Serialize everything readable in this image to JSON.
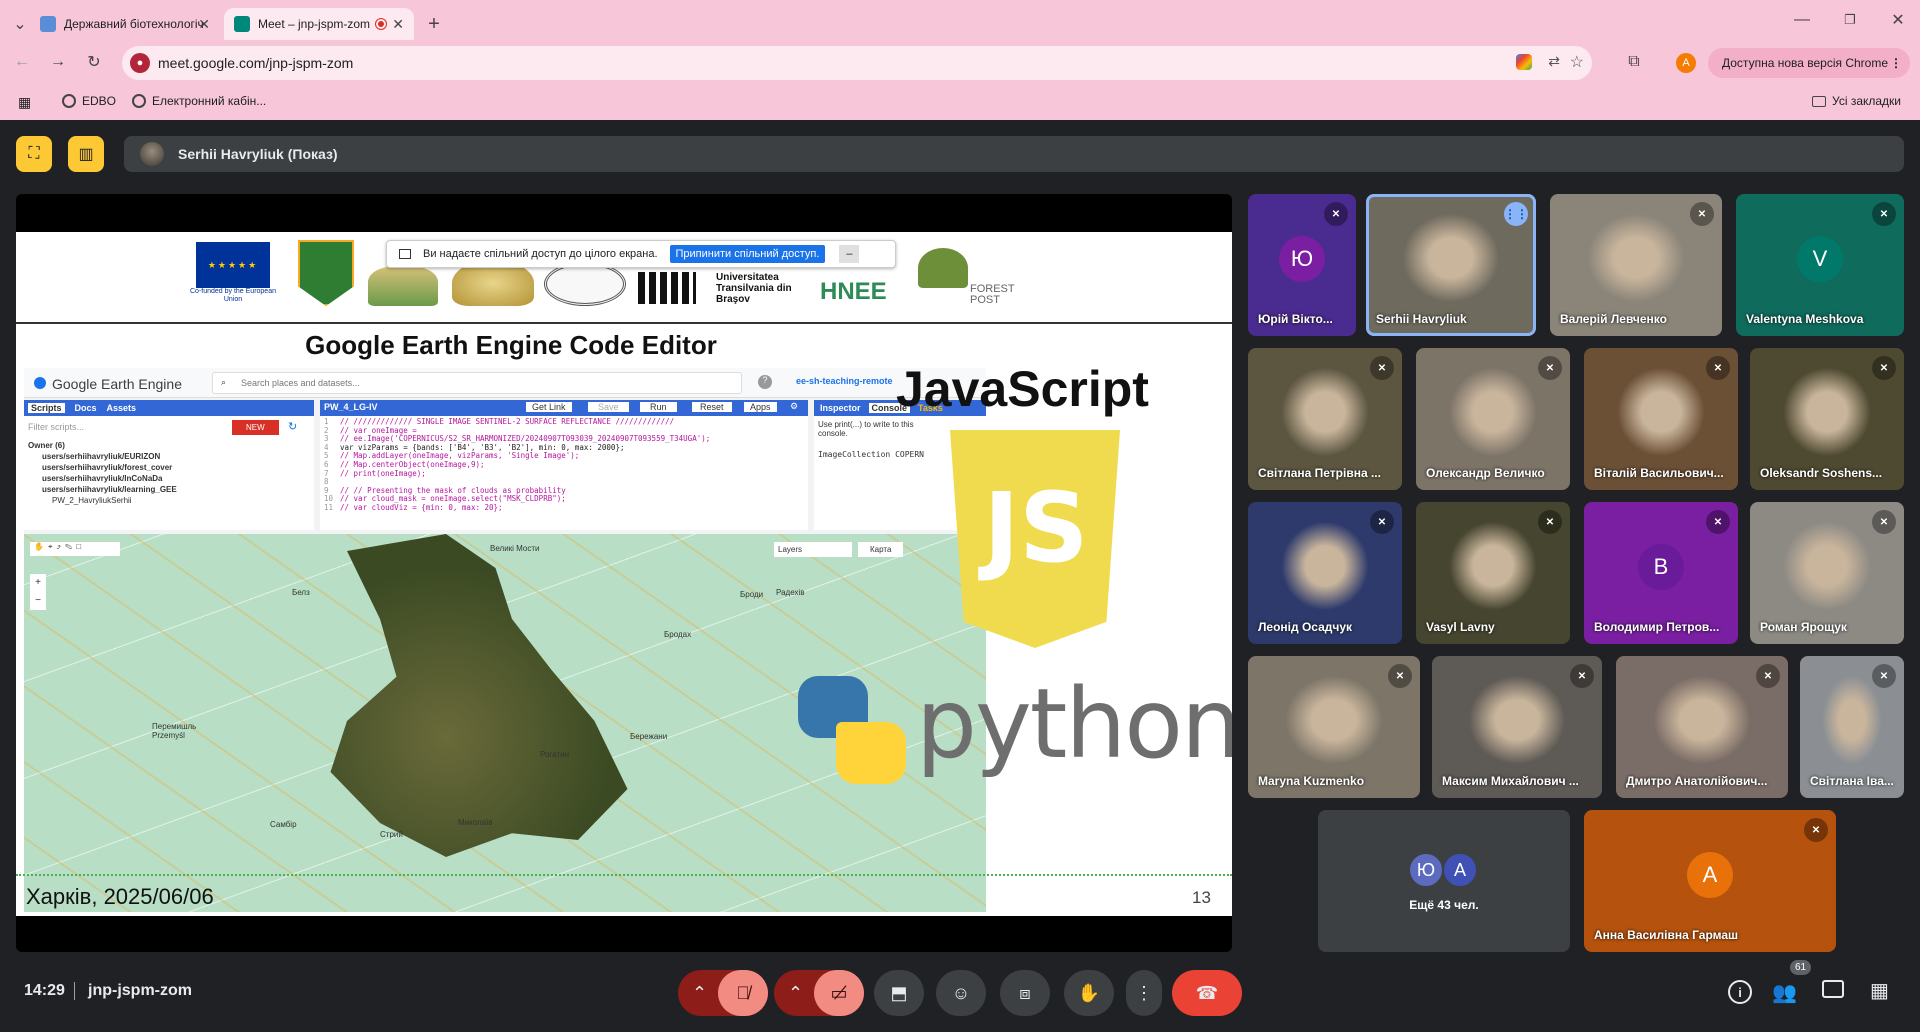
{
  "tabs": [
    {
      "label": "Державний біотехнологічний"
    },
    {
      "label": "Meet – jnp-jspm-zom"
    }
  ],
  "url": "meet.google.com/jnp-jspm-zom",
  "update_label": "Доступна нова версія Chrome",
  "profile_initial": "A",
  "bookmarks": [
    {
      "label": "EDBO"
    },
    {
      "label": "Електронний кабін..."
    }
  ],
  "all_bookmarks": "Усі закладки",
  "presenter": {
    "name": "Serhii Havryliuk (Показ)"
  },
  "share_banner": {
    "text": "Ви надаєте спільний доступ до цілого екрана.",
    "button": "Припинити спільний доступ."
  },
  "slide": {
    "title": "Google Earth Engine Code Editor",
    "footer_left": "Харків, 2025/06/06",
    "page_number": "13",
    "js_label": "JavaScript",
    "python_label": "python",
    "logo_texts": {
      "eu": "Co-funded by the European Union",
      "unitbv": "Universitatea Transilvania din Braşov",
      "hnee": "HNEE",
      "forest": "FOREST POST"
    },
    "gee": {
      "brand": "Google Earth Engine",
      "search_placeholder": "Search places and datasets...",
      "user_chip": "ee-sh-teaching-remote",
      "left_tabs": [
        "Scripts",
        "Docs",
        "Assets"
      ],
      "filter_placeholder": "Filter scripts...",
      "new_button": "NEW",
      "tree": [
        "Owner (6)",
        "users/serhiihavryliuk/EURIZON",
        "users/serhiihavryliuk/forest_cover",
        "users/serhiihavryliuk/InCoNaDa",
        "users/serhiihavryliuk/learning_GEE",
        "PW_2_HavryliukSerhii"
      ],
      "editor_tab": "PW_4_LG-IV",
      "editor_buttons": [
        "Get Link",
        "Save",
        "Run",
        "Reset",
        "Apps"
      ],
      "right_tabs": [
        "Inspector",
        "Console",
        "Tasks"
      ],
      "console_lines": [
        "Use print(...) to write to this console.",
        "ImageCollection COPERN"
      ],
      "code": [
        "// ///////////// SINGLE IMAGE SENTINEL-2 SURFACE REFLECTANCE /////////////",
        "// var oneImage =",
        "// ee.Image('COPERNICUS/S2_SR_HARMONIZED/20240907T093039_20240907T093559_T34UGA');",
        "var vizParams = {bands: ['B4', 'B3', 'B2'], min: 0, max: 2000};",
        "// Map.addLayer(oneImage, vizParams, 'Single Image');",
        "// Map.centerObject(oneImage,9);",
        "// print(oneImage);",
        "",
        "// // Presenting the mask of clouds as probability",
        "// var cloud_mask = oneImage.select(\"MSK_CLDPRB\");",
        "// var cloudViz = {min: 0, max: 20};"
      ],
      "map_buttons": [
        "Layers",
        "Карта"
      ],
      "map_places": [
        "Белз",
        "Великі Мости",
        "Перемишль Przemyśl",
        "Самбір",
        "Стрий",
        "Миколаїв",
        "Бережани",
        "Рогатин",
        "Броди",
        "Радехів",
        "Бродах"
      ]
    }
  },
  "participants": [
    {
      "name": "Юрій Вікто...",
      "initial": "Ю"
    },
    {
      "name": "Serhii Havryliuk"
    },
    {
      "name": "Валерій Левченко"
    },
    {
      "name": "Valentyna Meshkova",
      "initial": "V"
    },
    {
      "name": "Світлана Петрівна ..."
    },
    {
      "name": "Олександр Величко"
    },
    {
      "name": "Віталій Васильович..."
    },
    {
      "name": "Oleksandr Soshens..."
    },
    {
      "name": "Леонід Осадчук"
    },
    {
      "name": "Vasyl Lavny"
    },
    {
      "name": "Володимир Петров...",
      "initial": "В"
    },
    {
      "name": "Роман Ярощук"
    },
    {
      "name": "Maryna Kuzmenko"
    },
    {
      "name": "Максим Михайлович ..."
    },
    {
      "name": "Дмитро Анатолійович..."
    },
    {
      "name": "Світлана Іва..."
    },
    {
      "name": "Ещё 43 чел.",
      "initials": [
        "Ю",
        "A"
      ]
    },
    {
      "name": "Анна Василівна Гармаш",
      "initial": "А"
    }
  ],
  "bottom": {
    "time": "14:29",
    "meeting_code": "jnp-jspm-zom",
    "people_count": "61"
  },
  "colors": {
    "chrome_pink": "#f7c6d8",
    "meet_bg": "#202124",
    "end_call": "#ea4335",
    "js_yellow": "#f0db4f"
  }
}
